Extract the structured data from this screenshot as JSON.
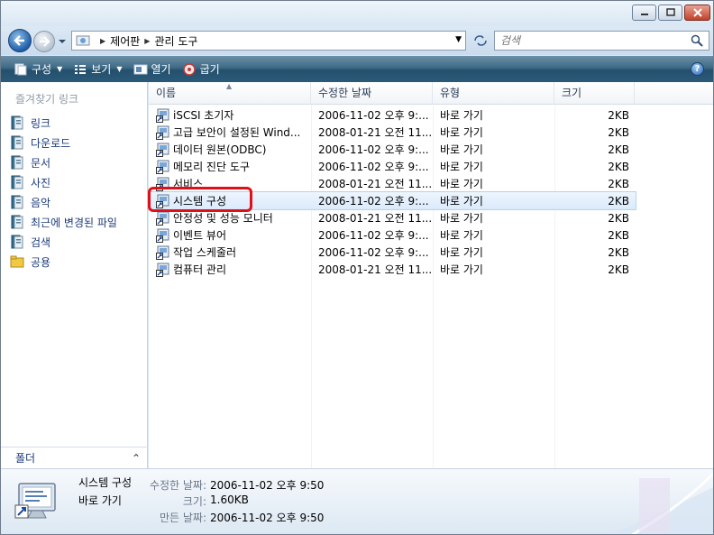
{
  "window": {
    "buttons": {
      "minimize": "minimize",
      "maximize": "maximize",
      "close": "close"
    }
  },
  "address": {
    "crumbs": [
      "제어판",
      "관리 도구"
    ],
    "search_placeholder": "검색"
  },
  "toolbar": {
    "organize": "구성",
    "view": "보기",
    "open": "열기",
    "burn": "굽기",
    "help": "?"
  },
  "left_pane": {
    "title": "즐겨찾기 링크",
    "items": [
      {
        "label": "링크",
        "icon": "links-icon"
      },
      {
        "label": "다운로드",
        "icon": "downloads-icon"
      },
      {
        "label": "문서",
        "icon": "documents-icon"
      },
      {
        "label": "사진",
        "icon": "pictures-icon"
      },
      {
        "label": "음악",
        "icon": "music-icon"
      },
      {
        "label": "최근에 변경된 파일",
        "icon": "recent-icon"
      },
      {
        "label": "검색",
        "icon": "search-folder-icon"
      },
      {
        "label": "공용",
        "icon": "public-icon"
      }
    ],
    "folders_label": "폴더"
  },
  "columns": {
    "name": "이름",
    "date": "수정한 날짜",
    "type": "유형",
    "size": "크기"
  },
  "files": [
    {
      "name": "iSCSI 초기자",
      "date": "2006-11-02 오후 9:...",
      "type": "바로 가기",
      "size": "2KB"
    },
    {
      "name": "고급 보안이 설정된 Wind...",
      "date": "2008-01-21 오전 11...",
      "type": "바로 가기",
      "size": "2KB"
    },
    {
      "name": "데이터 원본(ODBC)",
      "date": "2006-11-02 오후 9:...",
      "type": "바로 가기",
      "size": "2KB"
    },
    {
      "name": "메모리 진단 도구",
      "date": "2006-11-02 오후 9:...",
      "type": "바로 가기",
      "size": "2KB"
    },
    {
      "name": "서비스",
      "date": "2008-01-21 오전 11...",
      "type": "바로 가기",
      "size": "2KB"
    },
    {
      "name": "시스템 구성",
      "date": "2006-11-02 오후 9:...",
      "type": "바로 가기",
      "size": "2KB"
    },
    {
      "name": "안정성 및 성능 모니터",
      "date": "2008-01-21 오전 11...",
      "type": "바로 가기",
      "size": "2KB"
    },
    {
      "name": "이벤트 뷰어",
      "date": "2006-11-02 오후 9:...",
      "type": "바로 가기",
      "size": "2KB"
    },
    {
      "name": "작업 스케줄러",
      "date": "2006-11-02 오후 9:...",
      "type": "바로 가기",
      "size": "2KB"
    },
    {
      "name": "컴퓨터 관리",
      "date": "2008-01-21 오전 11...",
      "type": "바로 가기",
      "size": "2KB"
    }
  ],
  "selected_file": "시스템 구성",
  "details": {
    "name": "시스템 구성",
    "type": "바로 가기",
    "modified_label": "수정한 날짜:",
    "modified_value": "2006-11-02 오후 9:50",
    "size_label": "크기:",
    "size_value": "1.60KB",
    "created_label": "만든 날짜:",
    "created_value": "2006-11-02 오후 9:50"
  },
  "colors": {
    "toolbar": "#2b5a78",
    "selection": "#dbeafb",
    "highlight": "#e0101a",
    "link": "#1d3b7a"
  }
}
